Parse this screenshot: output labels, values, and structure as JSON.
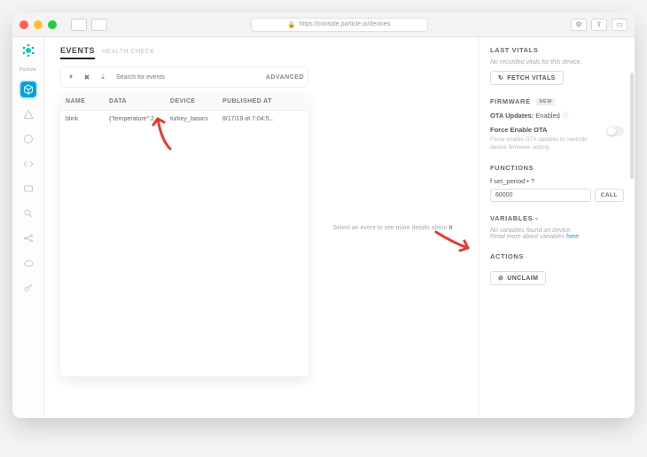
{
  "browser": {
    "url": "https://console.particle.io/devices"
  },
  "brand": "Particle",
  "events": {
    "title": "EVENTS",
    "subtitle": "HEALTH CHECK",
    "search_placeholder": "Search for events",
    "advanced": "ADVANCED",
    "columns": {
      "name": "NAME",
      "data": "DATA",
      "device": "DEVICE",
      "published": "PUBLISHED AT"
    },
    "rows": [
      {
        "name": "blink",
        "data": "{\"temperature\":2...",
        "device": "turkey_basics",
        "published": "8/17/19 at 7:04:5..."
      }
    ],
    "hint_prefix": "Select an event to see more details about",
    "hint_bold": "it"
  },
  "side": {
    "last_vitals": {
      "title": "LAST VITALS",
      "note": "No recorded vitals for this device.",
      "btn": "FETCH VITALS"
    },
    "firmware": {
      "title": "FIRMWARE",
      "badge": "NEW",
      "ota_label": "OTA Updates:",
      "ota_value": "Enabled",
      "force_label": "Force Enable OTA",
      "force_sub": "Force enable OTA updates to override device firmware setting."
    },
    "functions": {
      "title": "FUNCTIONS",
      "fn_name": "f  set_period • ?",
      "input_value": "60000",
      "call_btn": "CALL"
    },
    "variables": {
      "title": "VARIABLES",
      "note_a": "No variables found on device.",
      "note_b_prefix": "Read more about variables ",
      "note_b_link": "here"
    },
    "actions": {
      "title": "ACTIONS",
      "unclaim": "UNCLAIM"
    }
  }
}
